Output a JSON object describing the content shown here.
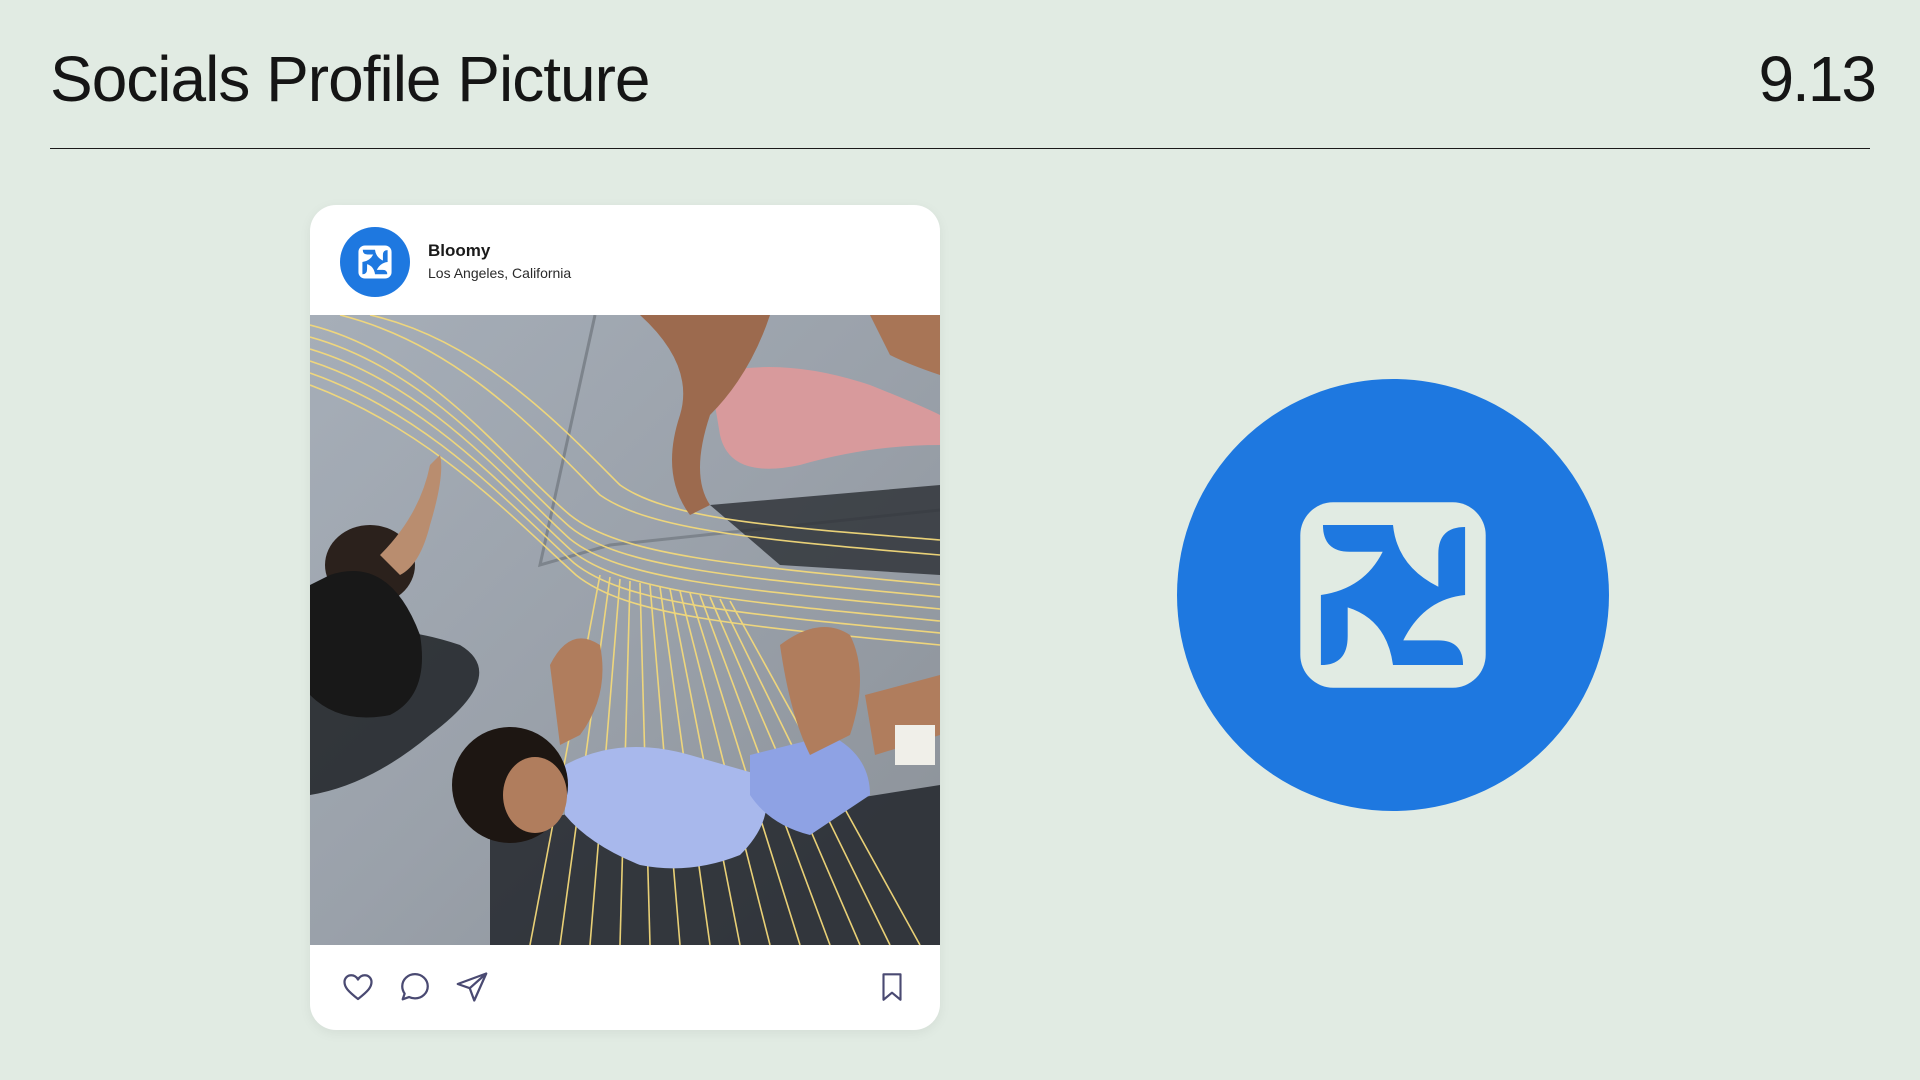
{
  "header": {
    "title": "Socials Profile Picture",
    "page_number": "9.13"
  },
  "post": {
    "username": "Bloomy",
    "location": "Los Angeles, California",
    "actions": {
      "like_icon": "heart-icon",
      "comment_icon": "comment-bubble-icon",
      "share_icon": "paper-plane-icon",
      "save_icon": "bookmark-icon"
    }
  },
  "brand": {
    "logo_icon": "bloomy-flower-logo",
    "color": "#1e78e0",
    "logo_foreground": "#e1ebe3",
    "background": "#e1ebe3",
    "accent_lines": "#f3d97a"
  }
}
